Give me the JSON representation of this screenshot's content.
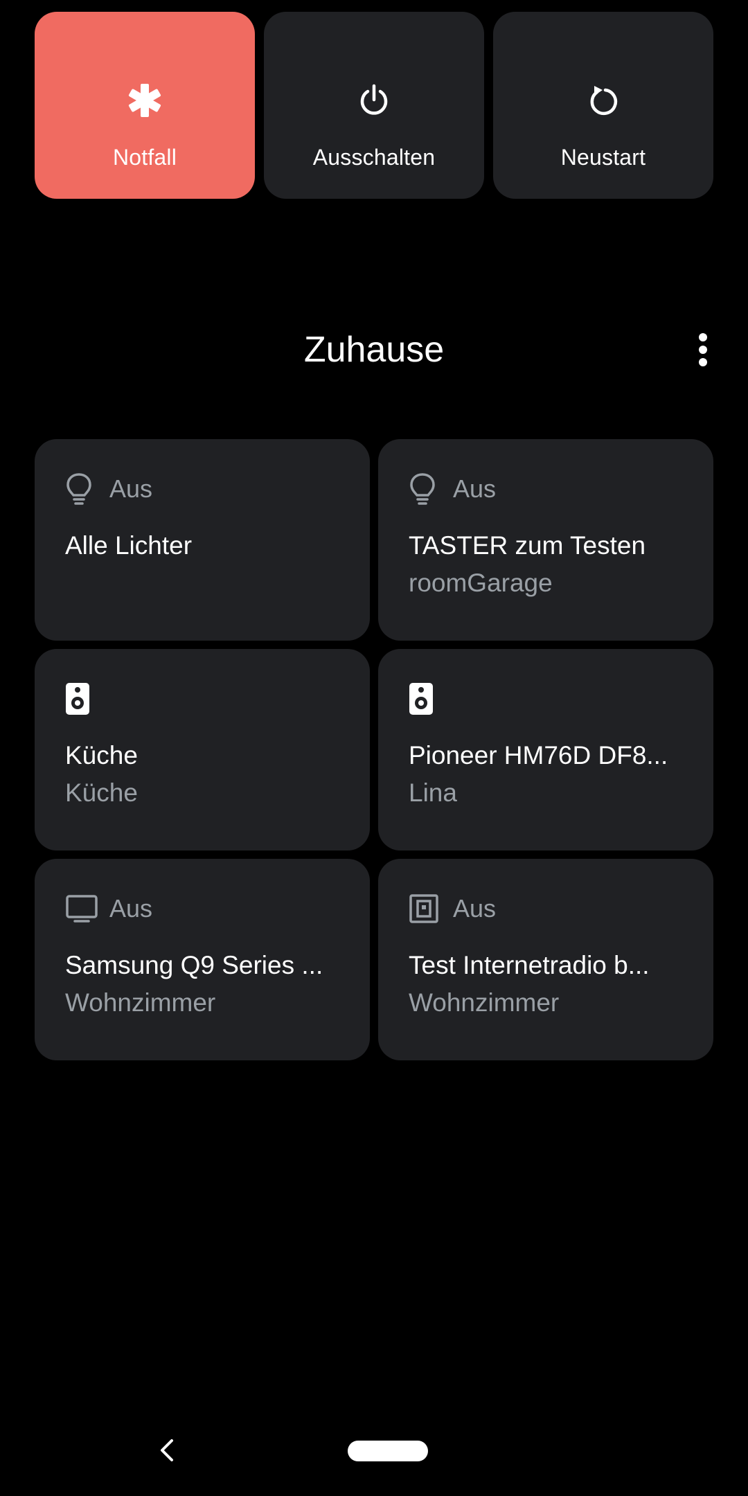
{
  "power_menu": {
    "emergency_label": "Notfall",
    "power_off_label": "Ausschalten",
    "restart_label": "Neustart",
    "emergency_color": "#f06b61"
  },
  "section": {
    "title": "Zuhause"
  },
  "devices": [
    {
      "icon": "lightbulb-icon",
      "status": "Aus",
      "name": "Alle Lichter",
      "room": ""
    },
    {
      "icon": "lightbulb-icon",
      "status": "Aus",
      "name": "TASTER zum Testen",
      "room": "roomGarage"
    },
    {
      "icon": "speaker-icon",
      "status": "",
      "name": "Küche",
      "room": "Küche"
    },
    {
      "icon": "speaker-icon",
      "status": "",
      "name": "Pioneer HM76D DF8...",
      "room": "Lina"
    },
    {
      "icon": "tv-icon",
      "status": "Aus",
      "name": "Samsung Q9 Series ...",
      "room": "Wohnzimmer"
    },
    {
      "icon": "media-device-icon",
      "status": "Aus",
      "name": "Test Internetradio b...",
      "room": "Wohnzimmer"
    }
  ],
  "colors": {
    "background": "#000000",
    "tile": "#202124",
    "secondary_text": "#9aa0a6"
  }
}
